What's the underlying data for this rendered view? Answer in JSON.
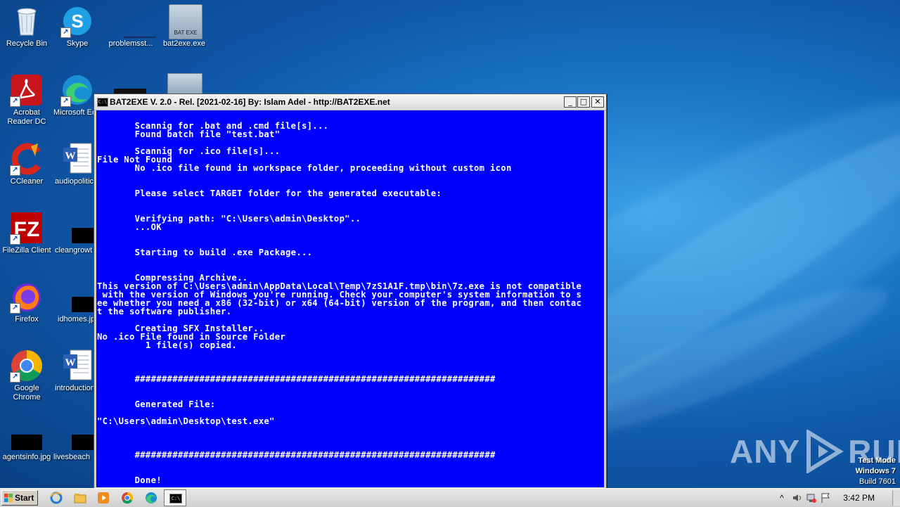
{
  "desktop": {
    "icons": [
      {
        "label": "Recycle Bin"
      },
      {
        "label": "Skype"
      },
      {
        "label": "problemsst..."
      },
      {
        "label": "bat2exe.exe"
      },
      {
        "label": "Acrobat Reader DC"
      },
      {
        "label": "Microsoft Ed"
      },
      {
        "label": "CCleaner"
      },
      {
        "label": "audiopolitic"
      },
      {
        "label": "FileZilla Client"
      },
      {
        "label": "cleangrowt"
      },
      {
        "label": "Firefox"
      },
      {
        "label": "idhomes.jp"
      },
      {
        "label": "Google Chrome"
      },
      {
        "label": "introduction"
      },
      {
        "label": "agentsinfo.jpg"
      },
      {
        "label": "livesbeach"
      }
    ],
    "bat2exe_icon_text": "BAT  EXE"
  },
  "console": {
    "title": "BAT2EXE V. 2.0 - Rel. [2021-02-16] By: Islam Adel - http://BAT2EXE.net",
    "min_glyph": "_",
    "max_glyph": "□",
    "close_glyph": "✕",
    "output": "\n       Scannig for .bat and .cmd file[s]...\n       Found batch file \"test.bat\"\n\n       Scannig for .ico file[s]...\nFile Not Found\n       No .ico file found in workspace folder, proceeding without custom icon\n\n\n       Please select TARGET folder for the generated executable:\n\n\n       Verifying path: \"C:\\Users\\admin\\Desktop\"..\n       ...OK\n\n\n       Starting to build .exe Package...\n\n\n       Compressing Archive..\nThis version of C:\\Users\\admin\\AppData\\Local\\Temp\\7zS1A1F.tmp\\bin\\7z.exe is not compatible\n with the version of Windows you're running. Check your computer's system information to s\nee whether you need a x86 (32-bit) or x64 (64-bit) version of the program, and then contac\nt the software publisher.\n\n       Creating SFX Installer..\nNo .ico File found in Source Folder\n         1 file(s) copied.\n\n\n\n       ###################################################################\n\n\n       Generated File:\n\n\"C:\\Users\\admin\\Desktop\\test.exe\"\n\n\n\n       ###################################################################\n\n\n       Done!"
  },
  "watermark": {
    "left": "ANY",
    "right": "RUN"
  },
  "system_info": {
    "line1": "Test Mode",
    "line2": "Windows 7",
    "line3": "Build 7601"
  },
  "taskbar": {
    "start_label": "Start",
    "clock": "3:42 PM"
  },
  "colors": {
    "console_bg": "#0000ff",
    "console_fg": "#ffffff",
    "desktop": "#1c78c9"
  }
}
